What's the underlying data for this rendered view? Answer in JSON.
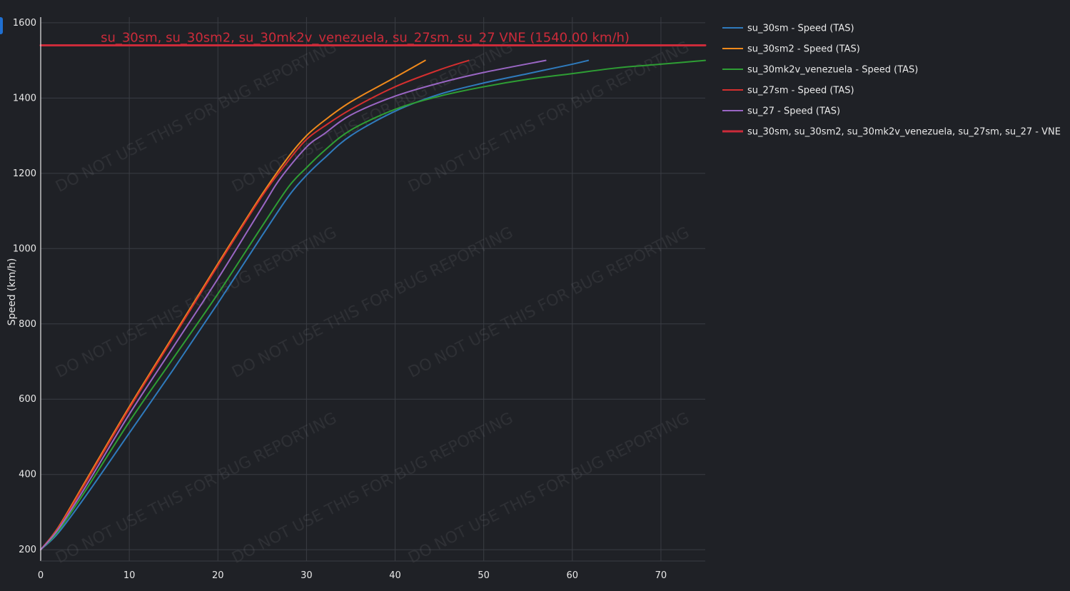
{
  "chart_data": {
    "type": "line",
    "title": "",
    "xlabel": "",
    "ylabel": "Speed (km/h)",
    "xlim": [
      0,
      75
    ],
    "ylim": [
      170,
      1615
    ],
    "x_ticks": [
      0,
      10,
      20,
      30,
      40,
      50,
      60,
      70
    ],
    "y_ticks": [
      200,
      400,
      600,
      800,
      1000,
      1200,
      1400,
      1600
    ],
    "grid": true,
    "legend_position": "right",
    "watermark": "DO NOT USE THIS FOR BUG REPORTING",
    "series": [
      {
        "name": "su_30sm - Speed (TAS)",
        "color": "#2f7bbd",
        "x": [
          0,
          2,
          5,
          10,
          15,
          20,
          25,
          28,
          30,
          32,
          35,
          40,
          45,
          50,
          55,
          60,
          61.8
        ],
        "y": [
          200,
          245,
          340,
          510,
          680,
          855,
          1035,
          1140,
          1195,
          1240,
          1300,
          1365,
          1410,
          1440,
          1465,
          1490,
          1500
        ]
      },
      {
        "name": "su_30sm2 - Speed (TAS)",
        "color": "#f08a1c",
        "x": [
          0,
          2,
          5,
          10,
          15,
          20,
          25,
          28,
          30,
          32,
          35,
          40,
          43.4
        ],
        "y": [
          200,
          260,
          380,
          580,
          770,
          960,
          1145,
          1245,
          1300,
          1340,
          1390,
          1455,
          1500
        ]
      },
      {
        "name": "su_30mk2v_venezuela - Speed (TAS)",
        "color": "#2e9e34",
        "x": [
          0,
          2,
          5,
          10,
          15,
          20,
          25,
          28,
          30,
          32,
          35,
          40,
          45,
          50,
          55,
          60,
          65,
          70,
          75
        ],
        "y": [
          200,
          250,
          355,
          540,
          710,
          880,
          1060,
          1165,
          1215,
          1260,
          1315,
          1370,
          1405,
          1430,
          1450,
          1465,
          1480,
          1490,
          1500
        ]
      },
      {
        "name": "su_27sm - Speed (TAS)",
        "color": "#d42f2f",
        "x": [
          0,
          2,
          5,
          10,
          15,
          20,
          25,
          28,
          30,
          32,
          35,
          40,
          45,
          48.3
        ],
        "y": [
          200,
          258,
          375,
          575,
          765,
          955,
          1140,
          1235,
          1290,
          1325,
          1370,
          1430,
          1475,
          1500
        ]
      },
      {
        "name": "su_27 - Speed (TAS)",
        "color": "#9a66c4",
        "x": [
          0,
          2,
          5,
          10,
          15,
          20,
          25,
          27,
          30,
          32,
          35,
          40,
          45,
          50,
          57
        ],
        "y": [
          200,
          255,
          365,
          560,
          740,
          920,
          1110,
          1185,
          1270,
          1305,
          1355,
          1405,
          1440,
          1468,
          1500
        ]
      },
      {
        "name": "su_30sm, su_30sm2, su_30mk2v_venezuela, su_27sm, su_27 - VNE",
        "color": "#cc2b3a",
        "x": [
          0,
          75
        ],
        "y": [
          1540,
          1540
        ]
      }
    ],
    "annotations": [
      {
        "text": "su_30sm, su_30sm2, su_30mk2v_venezuela, su_27sm, su_27 VNE (1540.00 km/h)",
        "x": 37.5,
        "y": 1540,
        "color": "#cc2b3a"
      }
    ]
  },
  "colors": {
    "background": "#1f2126",
    "grid": "#3a3d44",
    "axis_text": "#e8e8e8"
  }
}
